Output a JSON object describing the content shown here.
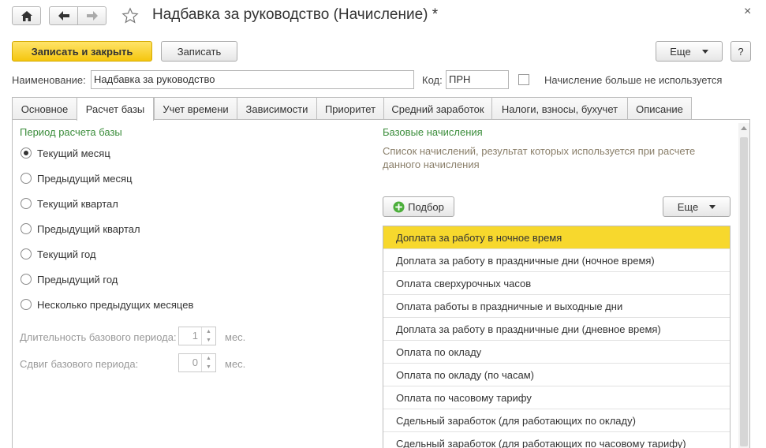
{
  "window": {
    "title": "Надбавка за руководство (Начисление) *",
    "close_glyph": "×",
    "icons": {
      "home": "home-icon",
      "back": "arrow-left-icon",
      "forward": "arrow-right-icon",
      "favorite": "star-icon"
    }
  },
  "toolbar": {
    "save_close_label": "Записать и закрыть",
    "save_label": "Записать",
    "more_label": "Еще",
    "help_label": "?"
  },
  "header": {
    "name_label": "Наименование:",
    "name_value": "Надбавка за руководство",
    "code_label": "Код:",
    "code_value": "ПРН",
    "unused_label": "Начисление больше не используется",
    "unused_checked": false
  },
  "tabs": [
    {
      "label": "Основное"
    },
    {
      "label": "Расчет базы"
    },
    {
      "label": "Учет времени"
    },
    {
      "label": "Зависимости"
    },
    {
      "label": "Приоритет"
    },
    {
      "label": "Средний заработок"
    },
    {
      "label": "Налоги, взносы, бухучет"
    },
    {
      "label": "Описание"
    }
  ],
  "active_tab": "Расчет базы",
  "period": {
    "title": "Период расчета базы",
    "options": [
      {
        "label": "Текущий месяц",
        "selected": true
      },
      {
        "label": "Предыдущий месяц",
        "selected": false
      },
      {
        "label": "Текущий квартал",
        "selected": false
      },
      {
        "label": "Предыдущий квартал",
        "selected": false
      },
      {
        "label": "Текущий год",
        "selected": false
      },
      {
        "label": "Предыдущий год",
        "selected": false
      },
      {
        "label": "Несколько предыдущих месяцев",
        "selected": false
      }
    ],
    "duration_label": "Длительность базового периода:",
    "duration_value": "1",
    "duration_unit": "мес.",
    "shift_label": "Сдвиг базового периода:",
    "shift_value": "0",
    "shift_unit": "мес."
  },
  "base": {
    "title": "Базовые начисления",
    "description": "Список начислений, результат которых используется при расчете данного начисления",
    "pick_label": "Подбор",
    "more_label": "Еще",
    "items": [
      "Доплата за работу в ночное время",
      "Доплата за работу в праздничные дни (ночное время)",
      "Оплата сверхурочных часов",
      "Оплата работы в праздничные и выходные дни",
      "Доплата за работу в праздничные дни (дневное время)",
      "Оплата по окладу",
      "Оплата по окладу (по часам)",
      "Оплата по часовому тарифу",
      "Сдельный заработок (для работающих по окладу)",
      "Сдельный заработок (для работающих по часовому тарифу)"
    ],
    "selected_index": 0
  },
  "colors": {
    "accent_yellow": "#f7d82d",
    "group_green": "#3b8d3b",
    "description": "#8a7f6a"
  }
}
